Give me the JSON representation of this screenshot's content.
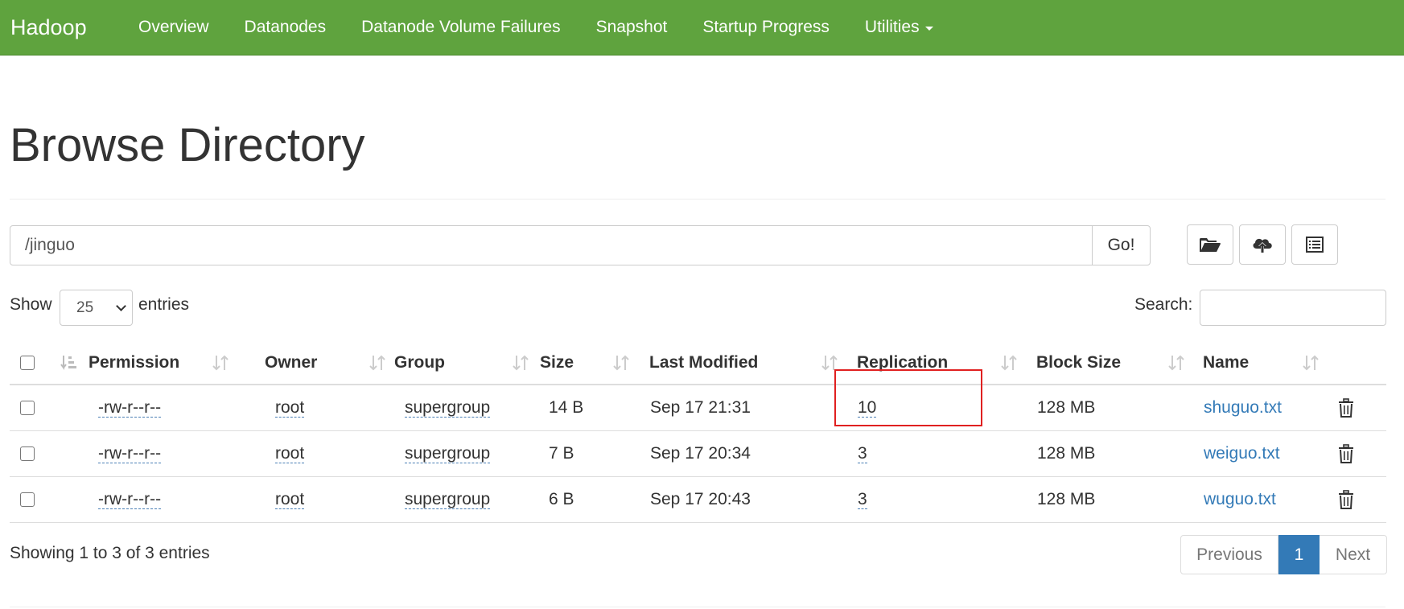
{
  "navbar": {
    "brand": "Hadoop",
    "items": [
      "Overview",
      "Datanodes",
      "Datanode Volume Failures",
      "Snapshot",
      "Startup Progress",
      "Utilities"
    ],
    "color": "#5fa33e"
  },
  "page": {
    "title": "Browse Directory"
  },
  "path_bar": {
    "value": "/jinguo",
    "go_label": "Go!"
  },
  "toolbar": {
    "icons": [
      "folder-open-icon",
      "cloud-upload-icon",
      "list-alt-icon"
    ]
  },
  "length_control": {
    "show_label": "Show",
    "selected": "25",
    "entries_label": "entries"
  },
  "search": {
    "label": "Search:",
    "value": ""
  },
  "table": {
    "columns": [
      "Permission",
      "Owner",
      "Group",
      "Size",
      "Last Modified",
      "Replication",
      "Block Size",
      "Name"
    ],
    "rows": [
      {
        "permission": "-rw-r--r--",
        "owner": "root",
        "group": "supergroup",
        "size": "14 B",
        "modified": "Sep 17 21:31",
        "replication": "10",
        "block_size": "128 MB",
        "name": "shuguo.txt"
      },
      {
        "permission": "-rw-r--r--",
        "owner": "root",
        "group": "supergroup",
        "size": "7 B",
        "modified": "Sep 17 20:34",
        "replication": "3",
        "block_size": "128 MB",
        "name": "weiguo.txt"
      },
      {
        "permission": "-rw-r--r--",
        "owner": "root",
        "group": "supergroup",
        "size": "6 B",
        "modified": "Sep 17 20:43",
        "replication": "3",
        "block_size": "128 MB",
        "name": "wuguo.txt"
      }
    ]
  },
  "footer": {
    "info": "Showing 1 to 3 of 3 entries",
    "pagination": {
      "previous": "Previous",
      "current": "1",
      "next": "Next"
    }
  },
  "colors": {
    "link": "#337ab7",
    "highlight": "#e02020"
  }
}
